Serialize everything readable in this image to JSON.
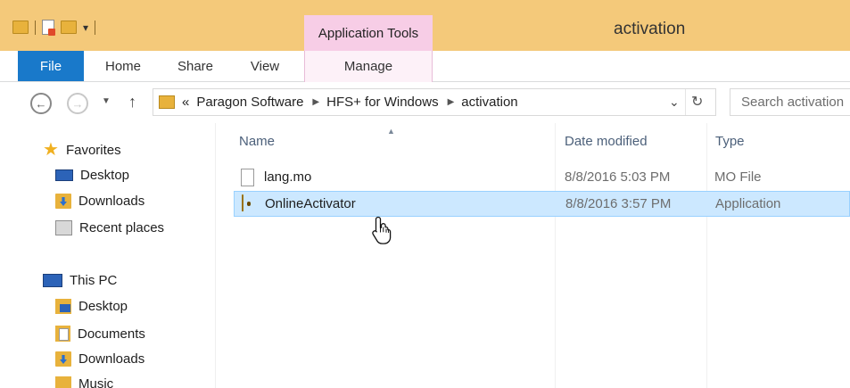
{
  "window": {
    "title": "activation",
    "contextual_tab_group": "Application Tools"
  },
  "ribbon": {
    "tabs": [
      {
        "label": "File",
        "active": true
      },
      {
        "label": "Home"
      },
      {
        "label": "Share"
      },
      {
        "label": "View"
      },
      {
        "label": "Manage"
      }
    ]
  },
  "address": {
    "overflow": "«",
    "crumbs": [
      "Paragon Software",
      "HFS+ for Windows",
      "activation"
    ]
  },
  "search": {
    "placeholder": "Search activation"
  },
  "navpane": {
    "favorites": {
      "label": "Favorites",
      "items": [
        "Desktop",
        "Downloads",
        "Recent places"
      ]
    },
    "this_pc": {
      "label": "This PC",
      "items": [
        "Desktop",
        "Documents",
        "Downloads",
        "Music"
      ]
    }
  },
  "filelist": {
    "columns": {
      "name": "Name",
      "date": "Date modified",
      "type": "Type"
    },
    "files": [
      {
        "name": "lang.mo",
        "date": "8/8/2016 5:03 PM",
        "type": "MO File",
        "icon": "file-icon"
      },
      {
        "name": "OnlineActivator",
        "date": "8/8/2016 3:57 PM",
        "type": "Application",
        "icon": "application-icon",
        "selected": true
      }
    ]
  },
  "colors": {
    "title_bar": "#f4c97a",
    "file_tab": "#1979ca",
    "app_tools": "#f7cde6",
    "selection": "#cce8ff"
  }
}
